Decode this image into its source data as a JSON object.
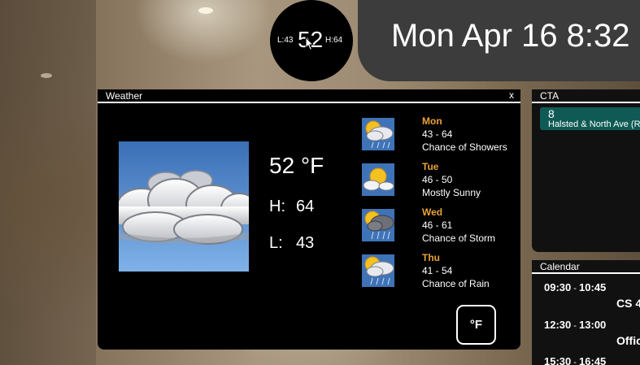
{
  "header": {
    "temp_low": "L:43",
    "temp_current": "52",
    "temp_high": "H:64",
    "clock": "Mon Apr 16 8:32"
  },
  "weather": {
    "title": "Weather",
    "close_label": "x",
    "current_icon": "cloudy-icon",
    "current_temp": "52 °F",
    "high_label": "H:",
    "high_value": "64",
    "low_label": "L:",
    "low_value": "43",
    "unit_button": "°F",
    "forecast": [
      {
        "day": "Mon",
        "range": "43 - 64",
        "desc": "Chance of Showers",
        "icon": "partly-cloudy-showers-icon"
      },
      {
        "day": "Tue",
        "range": "46 - 50",
        "desc": "Mostly Sunny",
        "icon": "mostly-sunny-icon"
      },
      {
        "day": "Wed",
        "range": "46 - 61",
        "desc": "Chance of Storm",
        "icon": "storm-icon"
      },
      {
        "day": "Thu",
        "range": "41 - 54",
        "desc": "Chance of Rain",
        "icon": "rain-icon"
      }
    ]
  },
  "cta": {
    "title": "CTA",
    "routes": [
      {
        "number": "8",
        "stop": "Halsted & North Ave (Re"
      }
    ]
  },
  "calendar": {
    "title": "Calendar",
    "events": [
      {
        "start": "09:30",
        "end": "10:45",
        "title": "CS 4"
      },
      {
        "start": "12:30",
        "end": "13:00",
        "title": "Offic"
      },
      {
        "start": "15:30",
        "end": "16:45",
        "title": ""
      }
    ]
  },
  "colors": {
    "forecast_day": "#e8a23a",
    "cta_route_bg": "#0f5a55",
    "clock_panel_bg": "#3c3c3c"
  }
}
